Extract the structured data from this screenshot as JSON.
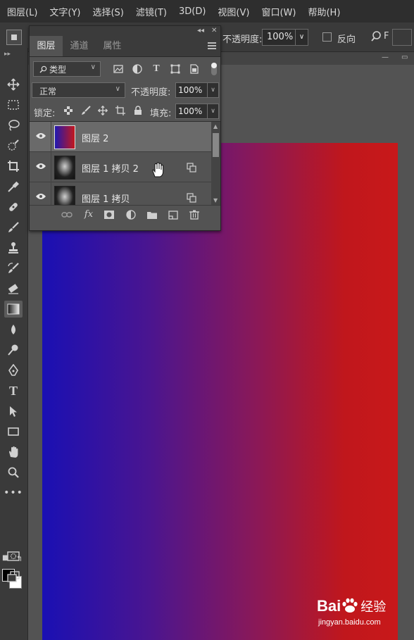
{
  "menu": [
    "图层(L)",
    "文字(Y)",
    "选择(S)",
    "滤镜(T)",
    "3D(D)",
    "视图(V)",
    "窗口(W)",
    "帮助(H)"
  ],
  "options_bar": {
    "opacity_label": "不透明度:",
    "opacity_value": "100%",
    "reverse_label": "反向",
    "mode_partial": "F"
  },
  "layers_panel": {
    "tabs": [
      "图层",
      "通道",
      "属性"
    ],
    "active_tab": "图层",
    "filter_kind": "类型",
    "blend_mode": "正常",
    "opacity_label": "不透明度:",
    "opacity_value": "100%",
    "lock_label": "锁定:",
    "fill_label": "填充:",
    "fill_value": "100%",
    "layers": [
      {
        "name": "图层 2",
        "selected": true,
        "thumb": "gradient"
      },
      {
        "name": "图层 1 拷贝 2",
        "selected": false,
        "thumb": "portrait"
      },
      {
        "name": "图层 1 拷贝",
        "selected": false,
        "thumb": "portrait"
      }
    ]
  },
  "canvas": {
    "gradient_start": "#1a10b3",
    "gradient_end": "#c8181a"
  },
  "watermark": {
    "brand_left": "Bai",
    "brand_right": "经验",
    "url": "jingyan.baidu.com"
  }
}
